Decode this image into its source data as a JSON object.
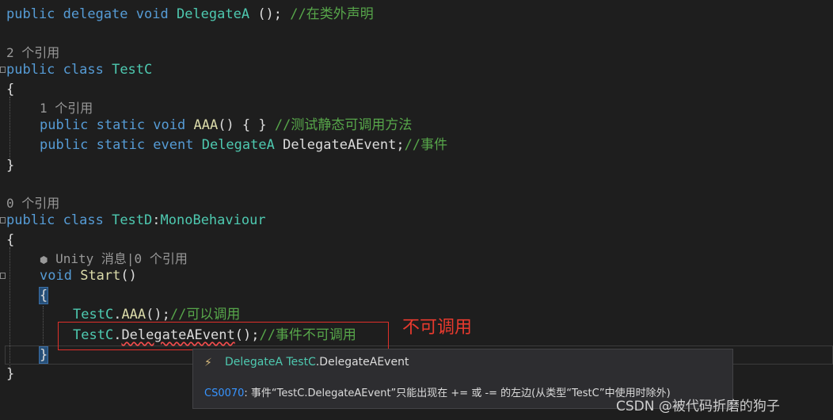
{
  "code": {
    "line1": {
      "kw": "public delegate void",
      "type": "DelegateA",
      "punct": " ();",
      "comment": " //在类外声明"
    },
    "lens1": "2 个引用",
    "line2": {
      "kw": "public class",
      "type": "TestC"
    },
    "brace_open_1": "{",
    "lens2": "1 个引用",
    "line3": {
      "kw": "public static void",
      "fn": "AAA",
      "punct": "() { }",
      "comment": " //测试静态可调用方法"
    },
    "line4": {
      "kw": "public static event",
      "type": "DelegateA",
      "ident": " DelegateAEvent;",
      "comment": "//事件"
    },
    "brace_close_1": "}",
    "lens3": "0 个引用",
    "line5": {
      "kw": "public class",
      "type": "TestD",
      "colon": ":",
      "base": "MonoBehaviour"
    },
    "brace_open_2": "{",
    "lens4": "Unity 消息|0 个引用",
    "line6": {
      "kw": "void",
      "fn": "Start",
      "punct": "()"
    },
    "brace_open_3": "{",
    "line7": {
      "type": "TestC",
      "dot": ".",
      "fn": "AAA",
      "punct": "();",
      "comment": "//可以调用"
    },
    "line8": {
      "type": "TestC",
      "dot": ".",
      "member": "DelegateAEvent",
      "punct": "();",
      "comment": "//事件不可调用"
    },
    "brace_close_3": "}",
    "brace_close_2": "}"
  },
  "annotation": {
    "text": "不可调用",
    "color": "#e83a2e"
  },
  "tooltip": {
    "icon": "lightning-icon",
    "sig_type": "DelegateA",
    "sig_class": " TestC",
    "sig_member": ".DelegateAEvent",
    "error_code": "CS0070",
    "error_text": ": 事件“TestC.DelegateAEvent”只能出现在 += 或 -= 的左边(从类型“TestC”中使用时除外)"
  },
  "watermark": "CSDN @被代码折磨的狗子",
  "colors": {
    "keyword": "#569cd6",
    "type": "#4ec9b0",
    "method": "#dcdcaa",
    "comment": "#57a64a",
    "background": "#1e1e1e",
    "error": "#f14c4c"
  }
}
